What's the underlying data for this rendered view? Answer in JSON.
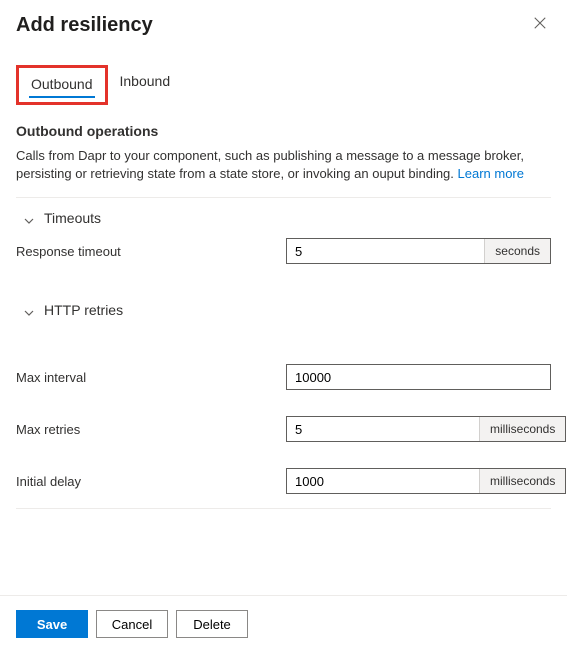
{
  "header": {
    "title": "Add resiliency"
  },
  "tabs": {
    "outbound": "Outbound",
    "inbound": "Inbound"
  },
  "section": {
    "title": "Outbound operations",
    "desc": "Calls from Dapr to your component, such as publishing a message to a message broker, persisting or retrieving state from a state store, or invoking an ouput binding. ",
    "learn_more": "Learn more"
  },
  "groups": {
    "timeouts": "Timeouts",
    "http_retries": "HTTP retries"
  },
  "fields": {
    "response_timeout": {
      "label": "Response timeout",
      "value": "5",
      "unit": "seconds"
    },
    "max_interval": {
      "label": "Max interval",
      "value": "10000"
    },
    "max_retries": {
      "label": "Max retries",
      "value": "5",
      "unit": "milliseconds"
    },
    "initial_delay": {
      "label": "Initial delay",
      "value": "1000",
      "unit": "milliseconds"
    }
  },
  "footer": {
    "save": "Save",
    "cancel": "Cancel",
    "delete": "Delete"
  }
}
